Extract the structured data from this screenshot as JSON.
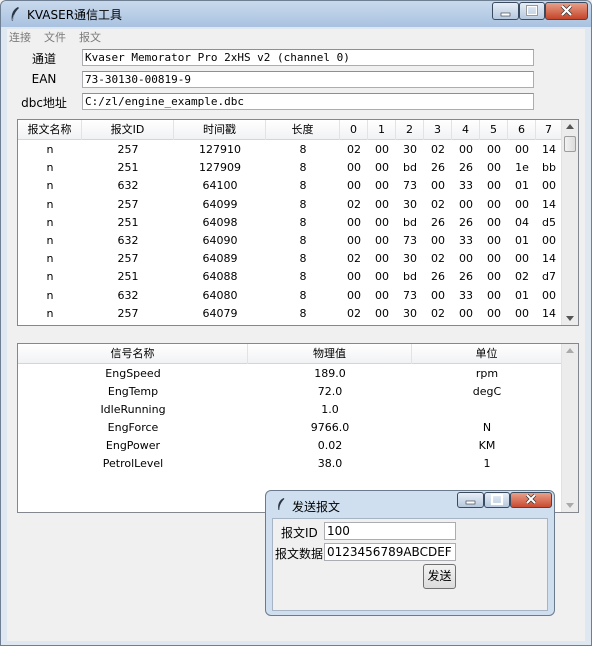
{
  "window": {
    "title": "KVASER通信工具"
  },
  "menu": [
    "连接",
    "文件",
    "报文"
  ],
  "info": {
    "channel_label": "通道",
    "channel_value": "Kvaser Memorator Pro 2xHS v2 (channel 0)",
    "ean_label": "EAN",
    "ean_value": "73-30130-00819-9",
    "dbc_label": "dbc地址",
    "dbc_value": "C:/zl/engine_example.dbc"
  },
  "message_table": {
    "columns": [
      "报文名称",
      "报文ID",
      "时间戳",
      "长度",
      "0",
      "1",
      "2",
      "3",
      "4",
      "5",
      "6",
      "7"
    ],
    "rows": [
      [
        "n",
        "257",
        "127910",
        "8",
        "02",
        "00",
        "30",
        "02",
        "00",
        "00",
        "00",
        "14"
      ],
      [
        "n",
        "251",
        "127909",
        "8",
        "00",
        "00",
        "bd",
        "26",
        "26",
        "00",
        "1e",
        "bb"
      ],
      [
        "n",
        "632",
        "64100",
        "8",
        "00",
        "00",
        "73",
        "00",
        "33",
        "00",
        "01",
        "00"
      ],
      [
        "n",
        "257",
        "64099",
        "8",
        "02",
        "00",
        "30",
        "02",
        "00",
        "00",
        "00",
        "14"
      ],
      [
        "n",
        "251",
        "64098",
        "8",
        "00",
        "00",
        "bd",
        "26",
        "26",
        "00",
        "04",
        "d5"
      ],
      [
        "n",
        "632",
        "64090",
        "8",
        "00",
        "00",
        "73",
        "00",
        "33",
        "00",
        "01",
        "00"
      ],
      [
        "n",
        "257",
        "64089",
        "8",
        "02",
        "00",
        "30",
        "02",
        "00",
        "00",
        "00",
        "14"
      ],
      [
        "n",
        "251",
        "64088",
        "8",
        "00",
        "00",
        "bd",
        "26",
        "26",
        "00",
        "02",
        "d7"
      ],
      [
        "n",
        "632",
        "64080",
        "8",
        "00",
        "00",
        "73",
        "00",
        "33",
        "00",
        "01",
        "00"
      ],
      [
        "n",
        "257",
        "64079",
        "8",
        "02",
        "00",
        "30",
        "02",
        "00",
        "00",
        "00",
        "14"
      ]
    ]
  },
  "signal_table": {
    "columns": [
      "信号名称",
      "物理值",
      "单位"
    ],
    "rows": [
      [
        "EngSpeed",
        "189.0",
        "rpm"
      ],
      [
        "EngTemp",
        "72.0",
        "degC"
      ],
      [
        "IdleRunning",
        "1.0",
        ""
      ],
      [
        "EngForce",
        "9766.0",
        "N"
      ],
      [
        "EngPower",
        "0.02",
        "KM"
      ],
      [
        "PetrolLevel",
        "38.0",
        "1"
      ]
    ]
  },
  "send_dialog": {
    "title": "发送报文",
    "id_label": "报文ID",
    "id_value": "100",
    "data_label": "报文数据",
    "data_value": "0123456789ABCDEF",
    "send_label": "发送"
  },
  "icons": {
    "app": "feather-icon",
    "minimize": "minimize-icon",
    "maximize": "maximize-icon",
    "close": "close-icon"
  },
  "colors": {
    "titlebar": "#b6cbe4",
    "close_button": "#c4452a",
    "dialog_close_button": "#c94a31"
  }
}
